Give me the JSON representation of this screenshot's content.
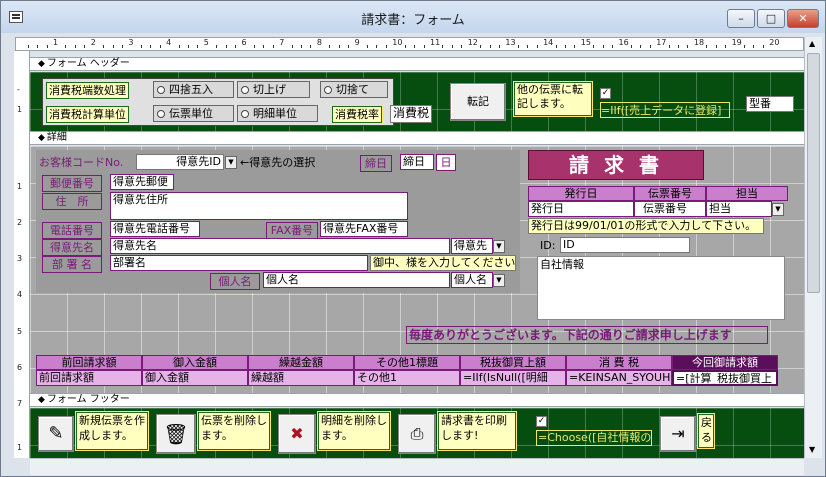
{
  "window": {
    "title": "請求書：フォーム",
    "min": "–",
    "max": "□",
    "close": "✕"
  },
  "ruler": {
    "marks": [
      "1",
      "2",
      "3",
      "4",
      "5",
      "6",
      "7",
      "8",
      "9",
      "10",
      "11",
      "12",
      "13",
      "14",
      "15",
      "16",
      "17",
      "18",
      "19",
      "20"
    ],
    "vmarks_header": [
      "-",
      "1"
    ],
    "vmarks_detail": [
      "1",
      "2",
      "3",
      "4",
      "5",
      "6",
      "7"
    ],
    "vmarks_footer": [
      "1"
    ]
  },
  "sections": {
    "header": "フォーム ヘッダー",
    "detail": "詳細",
    "footer": "フォーム フッター"
  },
  "header": {
    "rounding_label": "消費税端数処理",
    "rounding_options": [
      "四捨五入",
      "切上げ",
      "切捨て"
    ],
    "unit_label": "消費税計算単位",
    "unit_options": [
      "伝票単位",
      "明細単位"
    ],
    "tax_rate_label": "消費税率",
    "tax_rate_value": "消費税",
    "transfer_button": "転記",
    "transfer_note": "他の伝票に転記します。",
    "transfer_expr": "=IIf([売上データに登録]",
    "type_value": "型番"
  },
  "detail": {
    "customer_code_label": "お客様コードNo.",
    "customer_id_value": "得意先ID",
    "customer_select_note": "←得意先の選択",
    "closing_label": "締日",
    "closing_value": "締日",
    "closing_suffix": "日",
    "postal_label": "郵便番号",
    "postal_value": "得意先郵便",
    "address_label": "住　所",
    "address_value": "得意先住所",
    "phone_label": "電話番号",
    "phone_value": "得意先電話番号",
    "fax_label": "FAX番号",
    "fax_value": "得意先FAX番号",
    "customer_name_label": "得意先名",
    "customer_name_value": "得意先名",
    "customer_name_combo": "得意先",
    "dept_label": "部 署 名",
    "dept_value": "部署名",
    "dept_note": "御中、様を入力してください。",
    "person_label": "個人名",
    "person_value": "個人名",
    "person_combo": "個人名",
    "invoice_title": "請 求 書",
    "issue_date_header": "発行日",
    "slip_no_header": "伝票番号",
    "staff_header": "担当",
    "issue_date_value": "発行日",
    "slip_no_value": "伝票番号",
    "staff_value": "担当",
    "date_format_note": "発行日は99/01/01の形式で入力して下さい。",
    "id_label": "ID:",
    "id_value": "ID",
    "company_info": "自社情報",
    "thanks_message": "毎度ありがとうございます。下記の通りご請求申し上げます",
    "summary_headers": [
      "前回請求額",
      "御入金額",
      "繰越金額",
      "その他1標題",
      "税抜御買上額",
      "消 費 税",
      "今回御請求額"
    ],
    "summary_values": [
      "前回請求額",
      "御入金額",
      "繰越額",
      "その他1",
      "=IIf(IsNull([明細",
      "=KEINSAN_SYOUHIZE",
      "=[計算_税抜御買上"
    ]
  },
  "footer": {
    "new_slip": "新規伝票を作成します。",
    "delete_slip": "伝票を削除します。",
    "delete_detail": "明細を削除します。",
    "print_invoice": "請求書を印刷します!",
    "choose_expr": "=Choose([自社情報の",
    "back_label": "戻る"
  },
  "colors": {
    "green": "#064d10",
    "yellow": "#ffffbf",
    "purple": "#7a1a7a",
    "header_purple": "#c97fcb",
    "banner": "#a8326b"
  }
}
